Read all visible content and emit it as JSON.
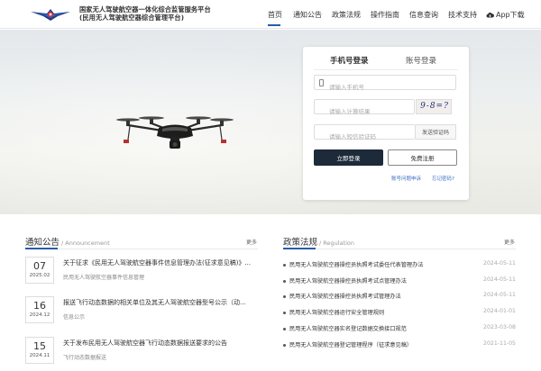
{
  "header": {
    "title_line1": "国家无人驾驶航空器一体化综合监管服务平台",
    "title_line2": "(民用无人驾驶航空器综合管理平台)",
    "nav": [
      "首页",
      "通知公告",
      "政策法规",
      "操作指南",
      "信息查询",
      "技术支持",
      "App下载"
    ],
    "accent_color": "#2a5caa"
  },
  "login": {
    "tab_phone": "手机号登录",
    "tab_account": "账号登录",
    "phone_placeholder": "请输入手机号",
    "calc_placeholder": "请输入计算结果",
    "captcha_text": "9-8=?",
    "sms_placeholder": "请输入短信验证码",
    "sms_button": "发送验证码",
    "login_button": "立即登录",
    "register_button": "免费注册",
    "help_link": "账号问题申诉",
    "forgot_link": "忘记密码?"
  },
  "notices": {
    "title": "通知公告",
    "subtitle": "Announcement",
    "more": "更多",
    "items": [
      {
        "day": "07",
        "ym": "2025.02",
        "title": "关于征求《民用无人驾驶航空器事件信息管理办法(征求意见稿)》...",
        "source": "民用无人驾驶航空器事件信息管理"
      },
      {
        "day": "16",
        "ym": "2024.12",
        "title": "报送飞行动态数据的相关单位及其无人驾驶航空器型号公示（动...",
        "source": "信息公示"
      },
      {
        "day": "15",
        "ym": "2024.11",
        "title": "关于发布民用无人驾驶航空器飞行动态数据报送要求的公告",
        "source": "飞行动态数据报送"
      }
    ]
  },
  "policies": {
    "title": "政策法规",
    "subtitle": "Regulation",
    "more": "更多",
    "items": [
      {
        "title": "民用无人驾驶航空器操控员执照考试委任代表管理办法",
        "date": "2024-05-11"
      },
      {
        "title": "民用无人驾驶航空器操控员执照考试点管理办法",
        "date": "2024-05-11"
      },
      {
        "title": "民用无人驾驶航空器操控员执照考试管理办法",
        "date": "2024-05-11"
      },
      {
        "title": "民用无人驾驶航空器运行安全管理规则",
        "date": "2024-01-01"
      },
      {
        "title": "民用无人驾驶航空器实名登记数据交换接口规范",
        "date": "2023-03-08"
      },
      {
        "title": "民用无人驾驶航空器登记管理程序（征求意见稿）",
        "date": "2021-11-05"
      }
    ]
  }
}
